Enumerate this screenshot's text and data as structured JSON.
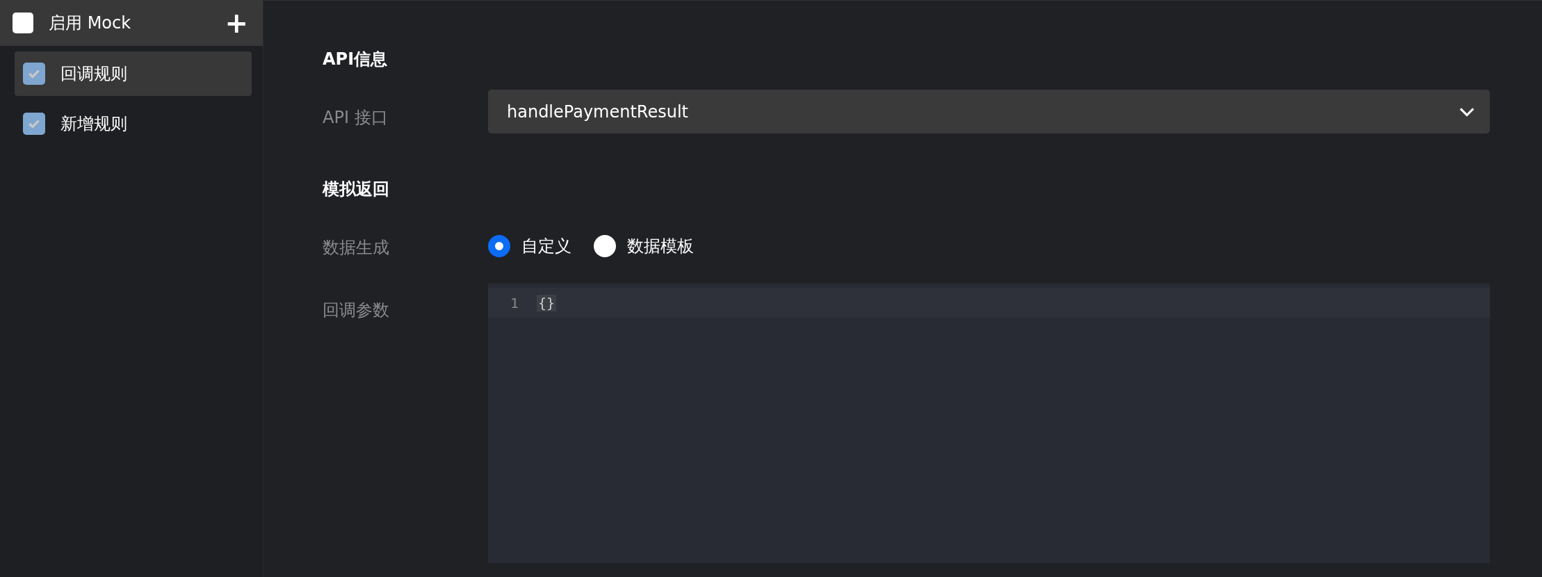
{
  "sidebar": {
    "header": {
      "label": "启用 Mock",
      "checked": false,
      "add_button": "+"
    },
    "items": [
      {
        "label": "回调规则",
        "checked": true,
        "selected": true
      },
      {
        "label": "新增规则",
        "checked": true,
        "selected": false
      }
    ]
  },
  "sections": [
    {
      "title": "API信息",
      "fields": [
        {
          "kind": "select",
          "label": "API 接口",
          "value": "handlePaymentResult"
        }
      ]
    },
    {
      "title": "模拟返回",
      "fields": [
        {
          "kind": "radio",
          "label": "数据生成",
          "options": [
            {
              "label": "自定义",
              "selected": true
            },
            {
              "label": "数据模板",
              "selected": false
            }
          ]
        },
        {
          "kind": "editor",
          "label": "回调参数",
          "lines": [
            {
              "number": "1",
              "text": "{}"
            }
          ]
        }
      ]
    }
  ]
}
